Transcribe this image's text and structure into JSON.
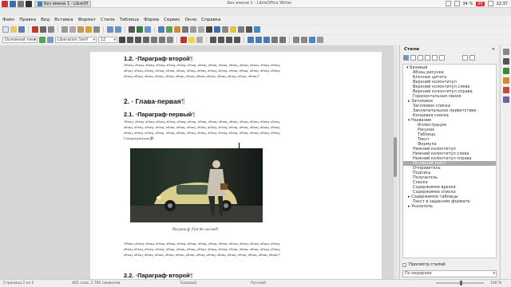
{
  "taskbar": {
    "task_label": "Без имени 1 - LibreOf",
    "window_title": "Без имени 1 - LibreOffice Writer",
    "battery": "34 %",
    "badge": "25",
    "time": "22:37"
  },
  "menu": [
    "Файл",
    "Правка",
    "Вид",
    "Вставка",
    "Формат",
    "Стили",
    "Таблица",
    "Форма",
    "Сервис",
    "Окно",
    "Справка"
  ],
  "toolbar2": {
    "style_value": "Основной текс",
    "font_value": "Liberation Serif",
    "size_value": "12"
  },
  "document": {
    "heading_1_2": "1.2. ·Параграф·второй",
    "para_top": "Абзац, абзац, абзац, абзац, абзац, абзац, абзац, абзац, абзац, абзац, абзац, абзац, абзац, абзац, абзац, абзац, абзац, абзац, абзац, абзац, абзац, абзац, абзац, абзац, абзац, абзац, абзац, абзац, абзац, абзац, абзац, абзац, абзац, абзац, абзац, абзац, абзац, абзац, абзац, абзац, абзац, абзац, абзац.",
    "heading_2": "2. · Глава·первая",
    "heading_2_1": "2.1. ·Параграф·первый",
    "para_mid": "Абзац, абзац, абзац, абзац, абзац, абзац, абзац, абзац, абзац, абзац, абзац, абзац, абзац, абзац, абзац, абзац, абзац, абзац, абзац, абзац, абзац, абзац, абзац, абзац, абзац, абзац, абзац, абзац, абзац, абзац, абзац, абзац, абзац, абзац, абзац, абзац, абзац, абзац, абзац, абзац, абзац, абзац, абзац, абзац, абзац. Смотри рисунок",
    "para_mid_ref": "2",
    "caption_prefix": "Рисунок",
    "caption_num": "2",
    "caption_text": ": Fiat the second",
    "para_bottom": "Абзац, абзац, абзац, абзац, абзац, абзац, абзац, абзац, абзац, абзац, абзац, абзац, абзац, абзац, абзац, абзац, абзац, абзац, абзац, абзац, абзац, абзац, абзац, абзац, абзац, абзац, абзац, абзац, абзац, абзац, абзац, абзац, абзац, абзац, абзац, абзац, абзац, абзац, абзац, абзац, абзац, абзац, абзац, абзац, абзац.",
    "heading_2_2": "2.2. ·Параграф·второй"
  },
  "sidebar": {
    "title": "Стили",
    "preview_label": "Просмотр стилей",
    "filter_value": "По иерархии",
    "items": [
      "▾ Базовый",
      "Абзац рисунка",
      "Блочная цитата",
      "Верхний колонтитул",
      "Верхний колонтитул слева",
      "Верхний колонтитул справа",
      "Горизонтальная линия",
      "▸ Заголовок",
      "Заголовок списка",
      "Заключительное приветствие",
      "Концевая сноска",
      "▾ Название",
      "Иллюстрация",
      "Рисунок",
      "Таблица",
      "Текст",
      "Формула",
      "Нижний колонтитул",
      "Нижний колонтитул слева",
      "Нижний колонтитул справа",
      "Основной текст",
      "Отправитель",
      "Подпись",
      "Получатель",
      "Сноска",
      "Содержимое врезки",
      "Содержимое списка",
      "▸ Содержимое таблицы",
      "Текст в заданном формате",
      "▸ Указатель"
    ],
    "selected_index": 20
  },
  "status": {
    "page": "Страница 2 из 5",
    "words": "405 слов, 2 785 символов",
    "page_style": "Базовый",
    "language": "Русский",
    "zoom": "100 %"
  },
  "colors": {
    "accent": "#3b82c4",
    "pilcrow": "#6a93c6"
  }
}
